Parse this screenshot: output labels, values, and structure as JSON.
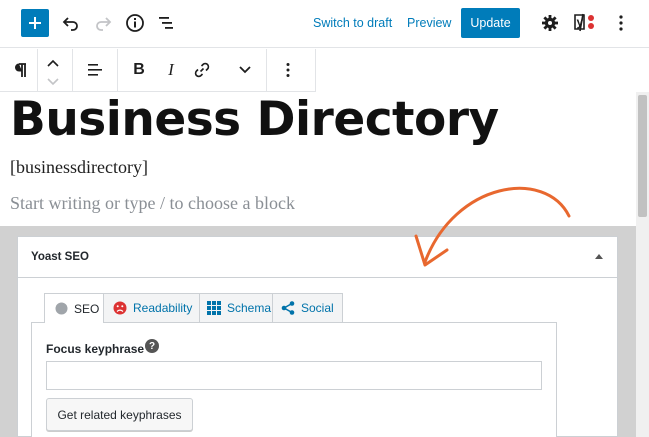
{
  "toolbar": {
    "add_block_icon": "plus-icon",
    "undo_icon": "undo-icon",
    "redo_icon": "redo-icon",
    "info_icon": "info-icon",
    "outline_icon": "list-view-icon",
    "switch_to_draft_label": "Switch to draft",
    "preview_label": "Preview",
    "update_label": "Update",
    "settings_icon": "gear-icon",
    "yoast_icon": "yoast-icon",
    "more_icon": "more-vertical-icon"
  },
  "block_toolbar": {
    "block_type_icon": "paragraph-icon",
    "move_up_icon": "chevron-up-icon",
    "move_down_icon": "chevron-down-icon",
    "align_icon": "align-left-icon",
    "bold_label": "B",
    "italic_label": "I",
    "link_icon": "link-icon",
    "more_formats_icon": "chevron-down-icon",
    "options_icon": "more-vertical-icon"
  },
  "editor": {
    "title": "Business Directory",
    "shortcode": "[businessdirectory]",
    "placeholder": "Start writing or type / to choose a block"
  },
  "yoast": {
    "title": "Yoast SEO",
    "tabs": [
      {
        "label": "SEO",
        "icon": "gray-circle-icon",
        "active": true
      },
      {
        "label": "Readability",
        "icon": "sad-face-icon",
        "active": false
      },
      {
        "label": "Schema",
        "icon": "grid-icon",
        "active": false
      },
      {
        "label": "Social",
        "icon": "share-icon",
        "active": false
      }
    ],
    "focus_keyphrase_label": "Focus keyphrase",
    "focus_keyphrase_value": "",
    "related_button_label": "Get related keyphrases"
  },
  "colors": {
    "accent": "#007cba",
    "arrow": "#e8682f",
    "readability_bad": "#dc3232",
    "seo_neutral": "#a0a5aa"
  }
}
